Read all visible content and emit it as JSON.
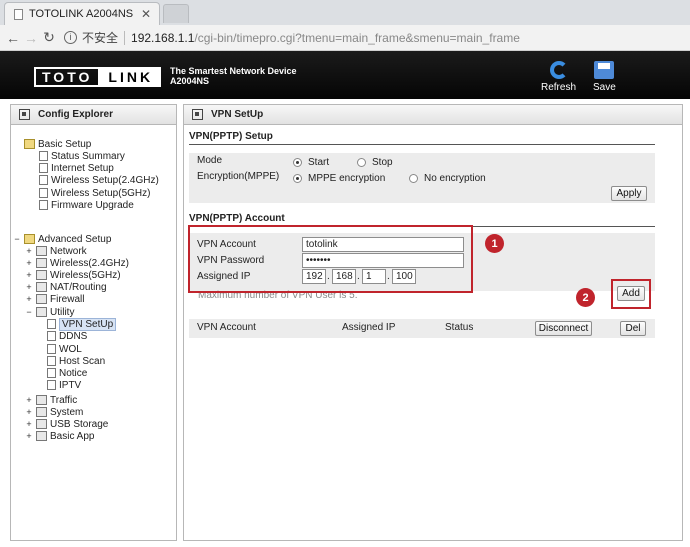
{
  "browser": {
    "tab_title": "TOTOLINK A2004NS",
    "tab_close": "✕",
    "insecure_label": "不安全",
    "url_host": "192.168.1.1",
    "url_path": "/cgi-bin/timepro.cgi?tmenu=main_frame&smenu=main_frame"
  },
  "header": {
    "logo_left": "TOTO",
    "logo_right": "LINK",
    "tagline_line1": "The Smartest Network Device",
    "tagline_line2": "A2004NS",
    "refresh_label": "Refresh",
    "save_label": "Save"
  },
  "explorer": {
    "title": "Config Explorer",
    "basic": {
      "label": "Basic Setup",
      "items": [
        "Status Summary",
        "Internet Setup",
        "Wireless Setup(2.4GHz)",
        "Wireless Setup(5GHz)",
        "Firmware Upgrade"
      ]
    },
    "advanced": {
      "label": "Advanced Setup",
      "expand": "−",
      "items": [
        "Network",
        "Wireless(2.4GHz)",
        "Wireless(5GHz)",
        "NAT/Routing",
        "Firewall",
        "Utility"
      ],
      "utility_items": [
        "VPN SetUp",
        "DDNS",
        "WOL",
        "Host Scan",
        "Notice",
        "IPTV"
      ],
      "more_items": [
        "Traffic",
        "System",
        "USB Storage",
        "Basic App"
      ]
    },
    "expand_plus": "+",
    "expand_minus": "−"
  },
  "content": {
    "title": "VPN SetUp",
    "pptp_setup": {
      "section_title": "VPN(PPTP) Setup",
      "mode_label": "Mode",
      "mode_start": "Start",
      "mode_stop": "Stop",
      "enc_label": "Encryption(MPPE)",
      "enc_mppe": "MPPE encryption",
      "enc_none": "No encryption",
      "apply_label": "Apply"
    },
    "account": {
      "section_title": "VPN(PPTP) Account",
      "account_label": "VPN Account",
      "account_value": "totolink",
      "password_label": "VPN Password",
      "password_value": "•••••••",
      "ip_label": "Assigned IP",
      "ip_octets": [
        "192",
        "168",
        "1",
        "100"
      ],
      "ip_dot": ".",
      "hint": "Maximum number of VPN User is 5.",
      "add_label": "Add"
    },
    "table": {
      "col_account": "VPN Account",
      "col_ip": "Assigned IP",
      "col_status": "Status",
      "disconnect_label": "Disconnect",
      "del_label": "Del"
    },
    "badges": [
      "1",
      "2"
    ]
  },
  "colors": {
    "annotation_red": "#c0242c",
    "header_bg": "#0a0a0a",
    "refresh_blue": "#3a8de0"
  }
}
